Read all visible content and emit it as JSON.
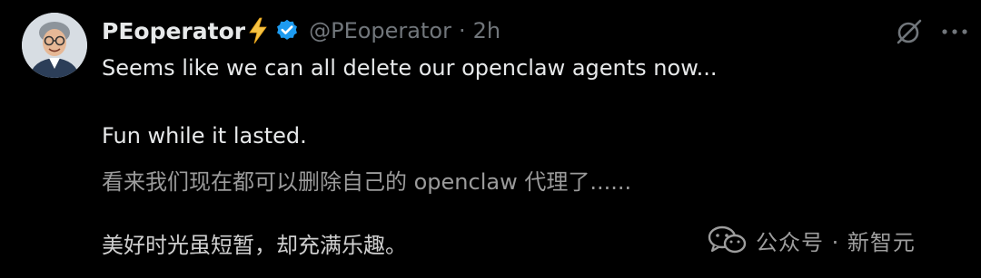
{
  "tweet": {
    "author": {
      "display_name": "PEoperator",
      "handle": "@PEoperator",
      "separator": "·",
      "time": "2h",
      "name_emoji": "bolt-icon",
      "verified": "verified-badge-icon"
    },
    "lines": [
      "Seems like we can all delete our openclaw agents now...",
      "Fun while it lasted.",
      "看来我们现在都可以删除自己的 openclaw 代理了......",
      "美好时光虽短暂，却充满乐趣。"
    ],
    "actions": {
      "grok_icon": "grok-icon",
      "more_icon": "more-icon"
    }
  },
  "watermark": {
    "icon": "wechat-icon",
    "text": "公众号 · 新智元"
  },
  "colors": {
    "background": "#000000",
    "primary_text": "#e7e9ea",
    "secondary_text": "#71767b",
    "verified_blue": "#1d9bf0",
    "bolt_yellow": "#f6c343"
  }
}
